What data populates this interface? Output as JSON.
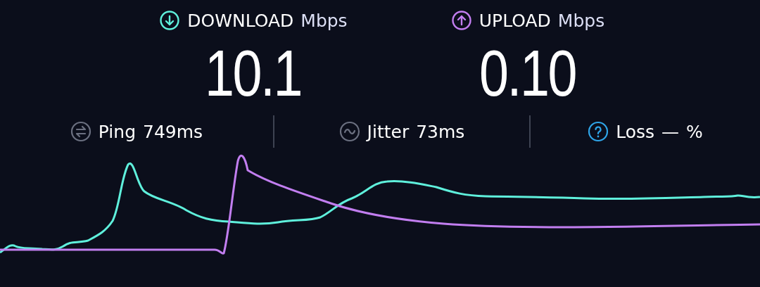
{
  "speeds": [
    {
      "kind": "download",
      "label": "DOWNLOAD",
      "unit": "Mbps",
      "value": "10.1",
      "color": "#5ff0dc"
    },
    {
      "kind": "upload",
      "label": "UPLOAD",
      "unit": "Mbps",
      "value": "0.10",
      "color": "#c27ef0"
    }
  ],
  "stats": [
    {
      "kind": "ping",
      "label": "Ping",
      "value": "749ms"
    },
    {
      "kind": "jitter",
      "label": "Jitter",
      "value": "73ms"
    },
    {
      "kind": "loss",
      "label": "Loss",
      "value": "—",
      "unit": "%"
    }
  ]
}
